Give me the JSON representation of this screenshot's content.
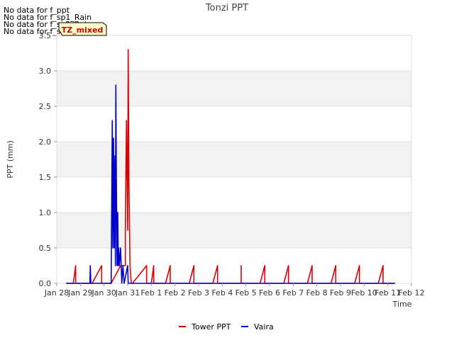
{
  "notices": [
    "No data for f_ppt",
    "No data for f_sp1_Rain",
    "No data for f_sp2_Rain",
    "No data for f_sp3_Rain"
  ],
  "badge": "TZ_mixed",
  "chart_data": {
    "type": "line",
    "title": "Tonzi PPT",
    "xlabel": "Time",
    "ylabel": "PPT (mm)",
    "xlim": [
      0,
      15
    ],
    "ylim": [
      0,
      3.5
    ],
    "yticks": [
      0.0,
      0.5,
      1.0,
      1.5,
      2.0,
      2.5,
      3.0,
      3.5
    ],
    "ytick_labels": [
      "0.0",
      "0.5",
      "1.0",
      "1.5",
      "2.0",
      "2.5",
      "3.0",
      "3.5"
    ],
    "xticks": [
      0,
      1,
      2,
      3,
      4,
      5,
      6,
      7,
      8,
      9,
      10,
      11,
      12,
      13,
      14,
      15
    ],
    "xtick_labels": [
      "Jan 28",
      "Jan 29",
      "Jan 30",
      "Jan 31",
      "Feb 1",
      "Feb 2",
      "Feb 3",
      "Feb 4",
      "Feb 5",
      "Feb 6",
      "Feb 7",
      "Feb 8",
      "Feb 9",
      "Feb 10",
      "Feb 11",
      "Feb 12"
    ],
    "legend_position": "bottom-center",
    "grid": true,
    "series": [
      {
        "name": "Tower PPT",
        "color": "#dd0000",
        "points": [
          [
            0.4,
            0
          ],
          [
            0.7,
            0
          ],
          [
            0.8,
            0.25
          ],
          [
            0.8,
            0
          ],
          [
            1.5,
            0
          ],
          [
            1.9,
            0.25
          ],
          [
            1.9,
            0
          ],
          [
            2.3,
            0
          ],
          [
            2.7,
            0.25
          ],
          [
            2.9,
            0.25
          ],
          [
            2.9,
            0.75
          ],
          [
            2.95,
            2.3
          ],
          [
            3.0,
            0.75
          ],
          [
            3.02,
            3.3
          ],
          [
            3.05,
            1.5
          ],
          [
            3.1,
            0.25
          ],
          [
            3.15,
            0
          ],
          [
            3.2,
            0
          ],
          [
            3.8,
            0.25
          ],
          [
            3.8,
            0
          ],
          [
            4.0,
            0
          ],
          [
            4.1,
            0.25
          ],
          [
            4.1,
            0
          ],
          [
            4.6,
            0
          ],
          [
            4.8,
            0.25
          ],
          [
            4.8,
            0
          ],
          [
            5.6,
            0
          ],
          [
            5.8,
            0.25
          ],
          [
            5.8,
            0
          ],
          [
            6.6,
            0
          ],
          [
            6.8,
            0.25
          ],
          [
            6.8,
            0
          ],
          [
            7.8,
            0
          ],
          [
            7.8,
            0.25
          ],
          [
            7.8,
            0
          ],
          [
            8.6,
            0
          ],
          [
            8.8,
            0.25
          ],
          [
            8.8,
            0
          ],
          [
            9.6,
            0
          ],
          [
            9.8,
            0.25
          ],
          [
            9.8,
            0
          ],
          [
            10.6,
            0
          ],
          [
            10.8,
            0.25
          ],
          [
            10.8,
            0
          ],
          [
            11.6,
            0
          ],
          [
            11.8,
            0.25
          ],
          [
            11.8,
            0
          ],
          [
            12.6,
            0
          ],
          [
            12.8,
            0.25
          ],
          [
            12.8,
            0
          ],
          [
            13.6,
            0
          ],
          [
            13.8,
            0.25
          ],
          [
            13.8,
            0
          ],
          [
            14.3,
            0
          ]
        ]
      },
      {
        "name": "Vaira",
        "color": "#0000cc",
        "points": [
          [
            0.4,
            0
          ],
          [
            1.4,
            0
          ],
          [
            1.42,
            0.25
          ],
          [
            1.44,
            0
          ],
          [
            2.3,
            0
          ],
          [
            2.35,
            2.3
          ],
          [
            2.37,
            0.5
          ],
          [
            2.4,
            2.05
          ],
          [
            2.43,
            0.5
          ],
          [
            2.46,
            1.8
          ],
          [
            2.48,
            0.25
          ],
          [
            2.5,
            2.8
          ],
          [
            2.52,
            1.5
          ],
          [
            2.55,
            0.25
          ],
          [
            2.58,
            1.0
          ],
          [
            2.6,
            0.25
          ],
          [
            2.62,
            0.5
          ],
          [
            2.65,
            0.25
          ],
          [
            2.7,
            0.5
          ],
          [
            2.75,
            0
          ],
          [
            2.8,
            0.25
          ],
          [
            2.85,
            0
          ],
          [
            3.0,
            0.25
          ],
          [
            3.02,
            0
          ],
          [
            14.3,
            0
          ]
        ]
      }
    ]
  }
}
